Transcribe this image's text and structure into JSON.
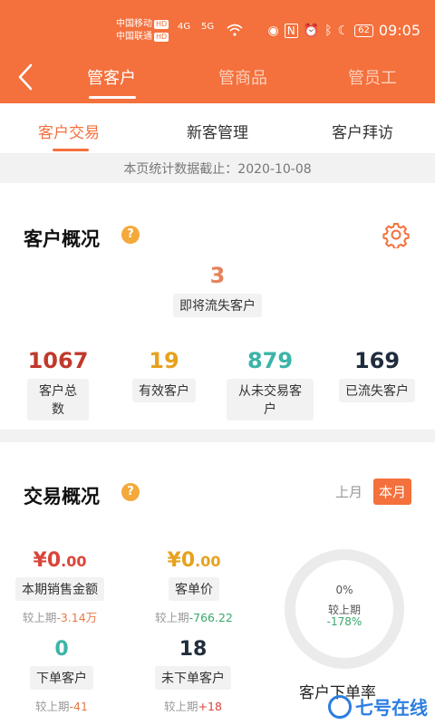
{
  "status_bar": {
    "carrier1": "中国移动",
    "carrier2": "中国联通",
    "hd": "HD",
    "sig1": "4G",
    "sig2": "5G",
    "battery": "62",
    "time": "09:05"
  },
  "nav": {
    "tabs": [
      {
        "label": "管客户",
        "active": true
      },
      {
        "label": "管商品",
        "active": false
      },
      {
        "label": "管员工",
        "active": false
      }
    ]
  },
  "subtabs": [
    {
      "label": "客户交易",
      "active": true
    },
    {
      "label": "新客管理",
      "active": false
    },
    {
      "label": "客户拜访",
      "active": false
    }
  ],
  "stat_date": "本页统计数据截止：2020-10-08",
  "customer_overview": {
    "title": "客户概况",
    "help": "?",
    "churning": {
      "value": "3",
      "label": "即将流失客户"
    },
    "stats": [
      {
        "value": "1067",
        "label": "客户总数",
        "color": "#c0392b"
      },
      {
        "value": "19",
        "label": "有效客户",
        "color": "#e6a21f"
      },
      {
        "value": "879",
        "label": "从未交易客户",
        "color": "#3cb4a8"
      },
      {
        "value": "169",
        "label": "已流失客户",
        "color": "#1f2d3d"
      }
    ]
  },
  "trade_overview": {
    "title": "交易概况",
    "help": "?",
    "periods": [
      {
        "label": "上月",
        "active": false
      },
      {
        "label": "本月",
        "active": true
      }
    ],
    "sales": {
      "currency": "¥",
      "main": "0",
      "dec": ".00",
      "label": "本期销售金额",
      "cmp_prefix": "较上期",
      "cmp_value": "-3.14万"
    },
    "unit_price": {
      "currency": "¥",
      "main": "0",
      "dec": ".00",
      "label": "客单价",
      "cmp_prefix": "较上期",
      "cmp_value": "-766.22"
    },
    "ordered": {
      "value": "0",
      "label": "下单客户",
      "cmp_prefix": "较上期",
      "cmp_value": "-41"
    },
    "not_ordered": {
      "value": "18",
      "label": "未下单客户",
      "cmp_prefix": "较上期",
      "cmp_value": "+18"
    },
    "ring": {
      "percent": "0%",
      "label": "较上期",
      "change": "-178%",
      "title": "客户下单率"
    }
  },
  "watermark": "七号在线",
  "colors": {
    "accent": "#f4703c",
    "help": "#f4a93b",
    "green": "#3aa86a"
  }
}
